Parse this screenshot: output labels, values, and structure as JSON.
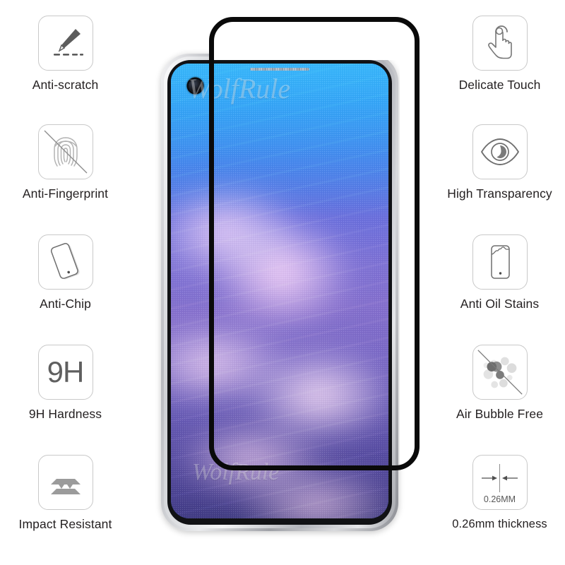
{
  "product": {
    "watermark": "WolfRule",
    "watermark_secondary": "WolfRule",
    "device_type": "smartphone",
    "accent_color": "#0a0a0a",
    "icon_border_color": "#c9c9c9",
    "label_color": "#231f20"
  },
  "features": {
    "left": [
      {
        "id": "anti-scratch",
        "label": "Anti-scratch",
        "icon": "scalpel-scratch-icon"
      },
      {
        "id": "anti-fingerprint",
        "label": "Anti-Fingerprint",
        "icon": "fingerprint-crossed-icon"
      },
      {
        "id": "anti-chip",
        "label": "Anti-Chip",
        "icon": "tilted-phone-icon"
      },
      {
        "id": "9h-hardness",
        "label": "9H Hardness",
        "icon": "nine-h-text-icon",
        "icon_text": "9H"
      },
      {
        "id": "impact-resistant",
        "label": "Impact Resistant",
        "icon": "layered-shield-icon"
      }
    ],
    "right": [
      {
        "id": "delicate-touch",
        "label": "Delicate Touch",
        "icon": "tap-hand-icon"
      },
      {
        "id": "high-transparency",
        "label": "High Transparency",
        "icon": "eye-icon"
      },
      {
        "id": "anti-oil-stains",
        "label": "Anti Oil Stains",
        "icon": "phone-oil-smudge-icon"
      },
      {
        "id": "air-bubble-free",
        "label": "Air Bubble Free",
        "icon": "bubbles-crossed-icon"
      },
      {
        "id": "thickness",
        "label": "0.26mm thickness",
        "icon": "thickness-arrows-icon",
        "icon_text": "0.26MM"
      }
    ]
  }
}
